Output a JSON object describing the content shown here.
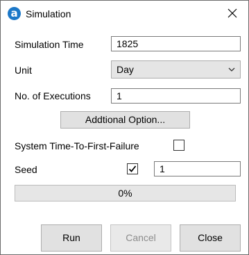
{
  "window": {
    "title": "Simulation",
    "app_icon_letter": "a"
  },
  "form": {
    "simulation_time_label": "Simulation Time",
    "simulation_time_value": "1825",
    "unit_label": "Unit",
    "unit_selected": "Day",
    "executions_label": "No. of Executions",
    "executions_value": "1",
    "additional_option_label": "Addtional Option...",
    "ttff_label": "System Time-To-First-Failure",
    "ttff_checked": false,
    "seed_label": "Seed",
    "seed_checked": true,
    "seed_value": "1"
  },
  "progress": {
    "percent": 0,
    "text": "0%"
  },
  "buttons": {
    "run": "Run",
    "cancel": "Cancel",
    "close": "Close"
  },
  "colors": {
    "app_icon": "#1c78c8",
    "progress_fill": "#06b025"
  },
  "icons": {
    "app": "app-logo-icon",
    "close": "close-icon",
    "dropdown": "chevron-down-icon",
    "check": "checkmark-icon"
  }
}
